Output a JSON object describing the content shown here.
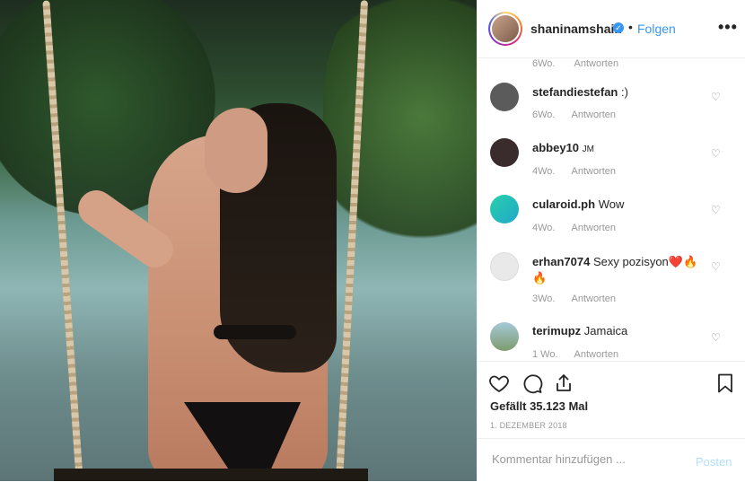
{
  "header": {
    "username": "shaninamshaik",
    "dot": "•",
    "follow_label": "Folgen",
    "more_label": "•••"
  },
  "comments": {
    "top_partial": {
      "age": "6Wo.",
      "reply": "Antworten"
    },
    "items": [
      {
        "user": "stefandiestefan",
        "text": ":)",
        "age": "6Wo.",
        "reply": "Antworten",
        "avatar_color": "#5b5b5b"
      },
      {
        "user": "abbey10",
        "text": "JM",
        "age": "4Wo.",
        "reply": "Antworten",
        "avatar_color": "#3a2b2d"
      },
      {
        "user": "cularoid.ph",
        "text": "Wow",
        "age": "4Wo.",
        "reply": "Antworten",
        "avatar_color": "#27c2a0"
      },
      {
        "user": "erhan7074",
        "text": "Sexy pozisyon❤️🔥🔥",
        "age": "3Wo.",
        "reply": "Antworten",
        "avatar_color": "#e9e9e9"
      },
      {
        "user": "terimupz",
        "text": "Jamaica",
        "age": "1 Wo.",
        "reply": "Antworten",
        "avatar_color": "#8fb0a4"
      }
    ]
  },
  "post": {
    "likes": "Gefällt 35.123 Mal",
    "date": "1. DEZEMBER 2018"
  },
  "comment_box": {
    "placeholder": "Kommentar hinzufügen ...",
    "post_label": "Posten"
  },
  "colors": {
    "accent": "#3897f0",
    "post_disabled": "#b2dffc"
  }
}
